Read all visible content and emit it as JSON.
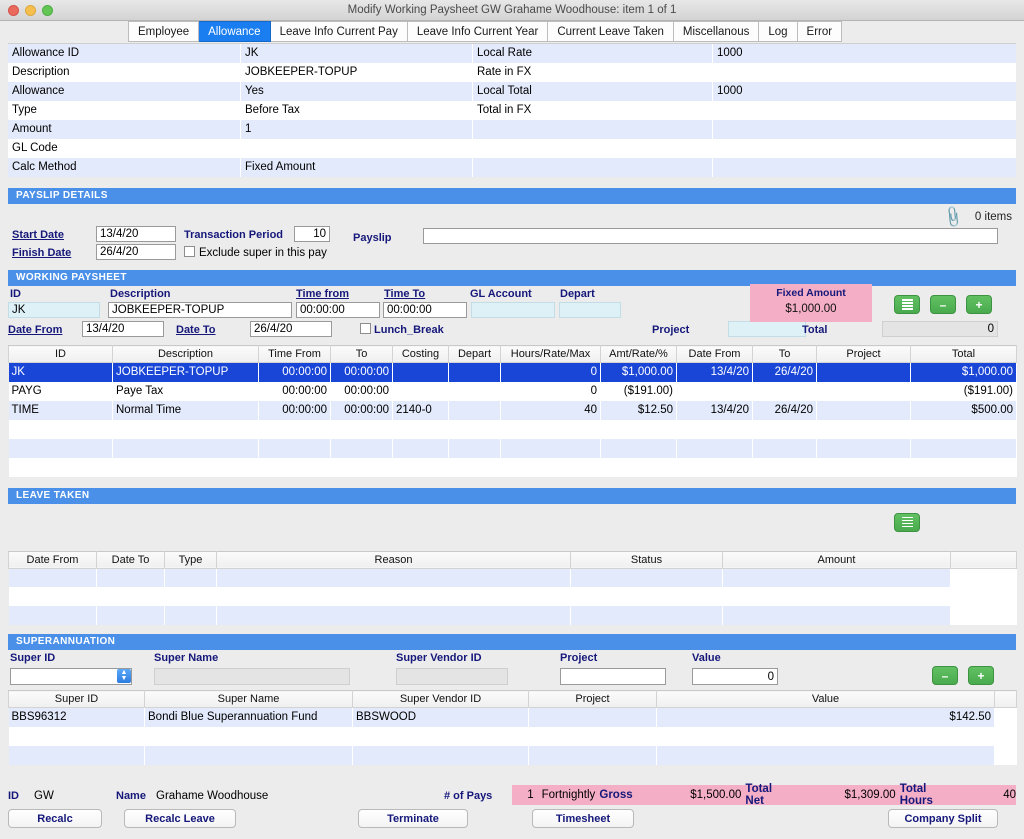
{
  "window": {
    "title": "Modify Working Paysheet GW Grahame Woodhouse: item 1  of  1",
    "controls": [
      "close",
      "minimize",
      "maximize"
    ]
  },
  "tabs": [
    {
      "label": "Employee",
      "active": false
    },
    {
      "label": "Allowance",
      "active": true
    },
    {
      "label": "Leave Info Current Pay",
      "active": false
    },
    {
      "label": "Leave Info Current Year",
      "active": false
    },
    {
      "label": "Current Leave Taken",
      "active": false
    },
    {
      "label": "Miscellanous",
      "active": false
    },
    {
      "label": "Log",
      "active": false
    },
    {
      "label": "Error",
      "active": false
    }
  ],
  "allowance_detail": {
    "rows": [
      {
        "label": "Allowance ID",
        "value": "JK",
        "label2": "Local Rate",
        "value2": "1000"
      },
      {
        "label": "Description",
        "value": "JOBKEEPER-TOPUP",
        "label2": "Rate in FX",
        "value2": ""
      },
      {
        "label": "Allowance",
        "value": "Yes",
        "label2": "Local Total",
        "value2": "1000"
      },
      {
        "label": "Type",
        "value": "Before Tax",
        "label2": "Total in FX",
        "value2": ""
      },
      {
        "label": "Amount",
        "value": "1",
        "label2": "",
        "value2": ""
      },
      {
        "label": "GL Code",
        "value": "",
        "label2": "",
        "value2": ""
      },
      {
        "label": "Calc Method",
        "value": "Fixed Amount",
        "label2": "",
        "value2": ""
      }
    ]
  },
  "payslip_details": {
    "section_title": "PAYSLIP DETAILS",
    "start_date_label": "Start Date",
    "start_date_value": "13/4/20",
    "finish_date_label": "Finish Date",
    "finish_date_value": "26/4/20",
    "transaction_period_label": "Transaction Period",
    "transaction_period_value": "10",
    "exclude_super_label": "Exclude super in this pay",
    "exclude_super_checked": false,
    "payslip_label": "Payslip",
    "payslip_value": "",
    "attachment_icon": "paperclip-icon",
    "items_count_text": "0 items"
  },
  "working_paysheet": {
    "section_title": "WORKING PAYSHEET",
    "form": {
      "id_label": "ID",
      "id_value": "JK",
      "description_label": "Description",
      "description_value": "JOBKEEPER-TOPUP",
      "time_from_label": "Time from",
      "time_from_value": "00:00:00",
      "time_to_label": "Time To",
      "time_to_value": "00:00:00",
      "gl_account_label": "GL Account",
      "gl_account_value": "",
      "depart_label": "Depart",
      "depart_value": "",
      "date_from_label": "Date From",
      "date_from_value": "13/4/20",
      "date_to_label": "Date To",
      "date_to_value": "26/4/20",
      "lunch_break_label": "Lunch_Break",
      "lunch_break_checked": false,
      "project_label": "Project",
      "project_value": "",
      "total_label": "Total",
      "total_value": "0",
      "fixed_amount_label": "Fixed Amount",
      "fixed_amount_value": "$1,000.00",
      "buttons": [
        "list-icon",
        "minus-icon",
        "plus-icon"
      ]
    },
    "columns": [
      "ID",
      "Description",
      "Time From",
      "To",
      "Costing",
      "Depart",
      "Hours/Rate/Max",
      "Amt/Rate/%",
      "Date From",
      "To",
      "Project",
      "Total"
    ],
    "rows": [
      {
        "selected": true,
        "cells": [
          "JK",
          "JOBKEEPER-TOPUP",
          "00:00:00",
          "00:00:00",
          "",
          "",
          "0",
          "$1,000.00",
          "13/4/20",
          "26/4/20",
          "",
          "$1,000.00"
        ]
      },
      {
        "selected": false,
        "cells": [
          "PAYG",
          "Paye Tax",
          "00:00:00",
          "00:00:00",
          "",
          "",
          "0",
          "($191.00)",
          "",
          "",
          "",
          "($191.00)"
        ]
      },
      {
        "selected": false,
        "cells": [
          "TIME",
          "Normal Time",
          "00:00:00",
          "00:00:00",
          "2140-0",
          "",
          "40",
          "$12.50",
          "13/4/20",
          "26/4/20",
          "",
          "$500.00"
        ]
      },
      {
        "selected": false,
        "cells": [
          "",
          "",
          "",
          "",
          "",
          "",
          "",
          "",
          "",
          "",
          "",
          ""
        ]
      },
      {
        "selected": false,
        "cells": [
          "",
          "",
          "",
          "",
          "",
          "",
          "",
          "",
          "",
          "",
          "",
          ""
        ]
      },
      {
        "selected": false,
        "cells": [
          "",
          "",
          "",
          "",
          "",
          "",
          "",
          "",
          "",
          "",
          "",
          ""
        ]
      }
    ]
  },
  "leave_taken": {
    "section_title": "LEAVE TAKEN",
    "button": "list-icon",
    "columns": [
      "Date From",
      "Date To",
      "Type",
      "Reason",
      "Status",
      "Amount"
    ],
    "rows": [
      {
        "cells": [
          "",
          "",
          "",
          "",
          "",
          ""
        ]
      },
      {
        "cells": [
          "",
          "",
          "",
          "",
          "",
          ""
        ]
      },
      {
        "cells": [
          "",
          "",
          "",
          "",
          "",
          ""
        ]
      }
    ]
  },
  "superannuation": {
    "section_title": "SUPERANNUATION",
    "form": {
      "super_id_label": "Super ID",
      "super_id_value": "",
      "super_name_label": "Super Name",
      "super_name_value": "",
      "super_vendor_id_label": "Super Vendor ID",
      "super_vendor_id_value": "",
      "project_label": "Project",
      "project_value": "",
      "value_label": "Value",
      "value_value": "0",
      "buttons": [
        "minus-icon",
        "plus-icon"
      ]
    },
    "columns": [
      "Super ID",
      "Super Name",
      "Super Vendor ID",
      "Project",
      "Value"
    ],
    "rows": [
      {
        "cells": [
          "BBS96312",
          "Bondi Blue Superannuation Fund",
          "BBSWOOD",
          "",
          "$142.50"
        ]
      },
      {
        "cells": [
          "",
          "",
          "",
          "",
          ""
        ]
      },
      {
        "cells": [
          "",
          "",
          "",
          "",
          ""
        ]
      }
    ]
  },
  "footer": {
    "id_label": "ID",
    "id_value": "GW",
    "name_label": "Name",
    "name_value": "Grahame Woodhouse",
    "num_pays_label": "# of Pays",
    "num_pays_value": "1",
    "frequency_value": "Fortnightly",
    "gross_label": "Gross",
    "gross_value": "$1,500.00",
    "total_net_label": "Total Net",
    "total_net_value": "$1,309.00",
    "total_hours_label": "Total Hours",
    "total_hours_value": "40",
    "buttons": [
      {
        "label": "Recalc"
      },
      {
        "label": "Recalc Leave"
      },
      {
        "label": "Terminate"
      },
      {
        "label": "Timesheet"
      },
      {
        "label": "Company Split"
      }
    ]
  },
  "colors": {
    "section_header": "#4a90e8",
    "selected_row": "#1a46d8",
    "pink": "#f4afc6",
    "green_button": "#49ab4e",
    "blue_label": "#15187a"
  }
}
